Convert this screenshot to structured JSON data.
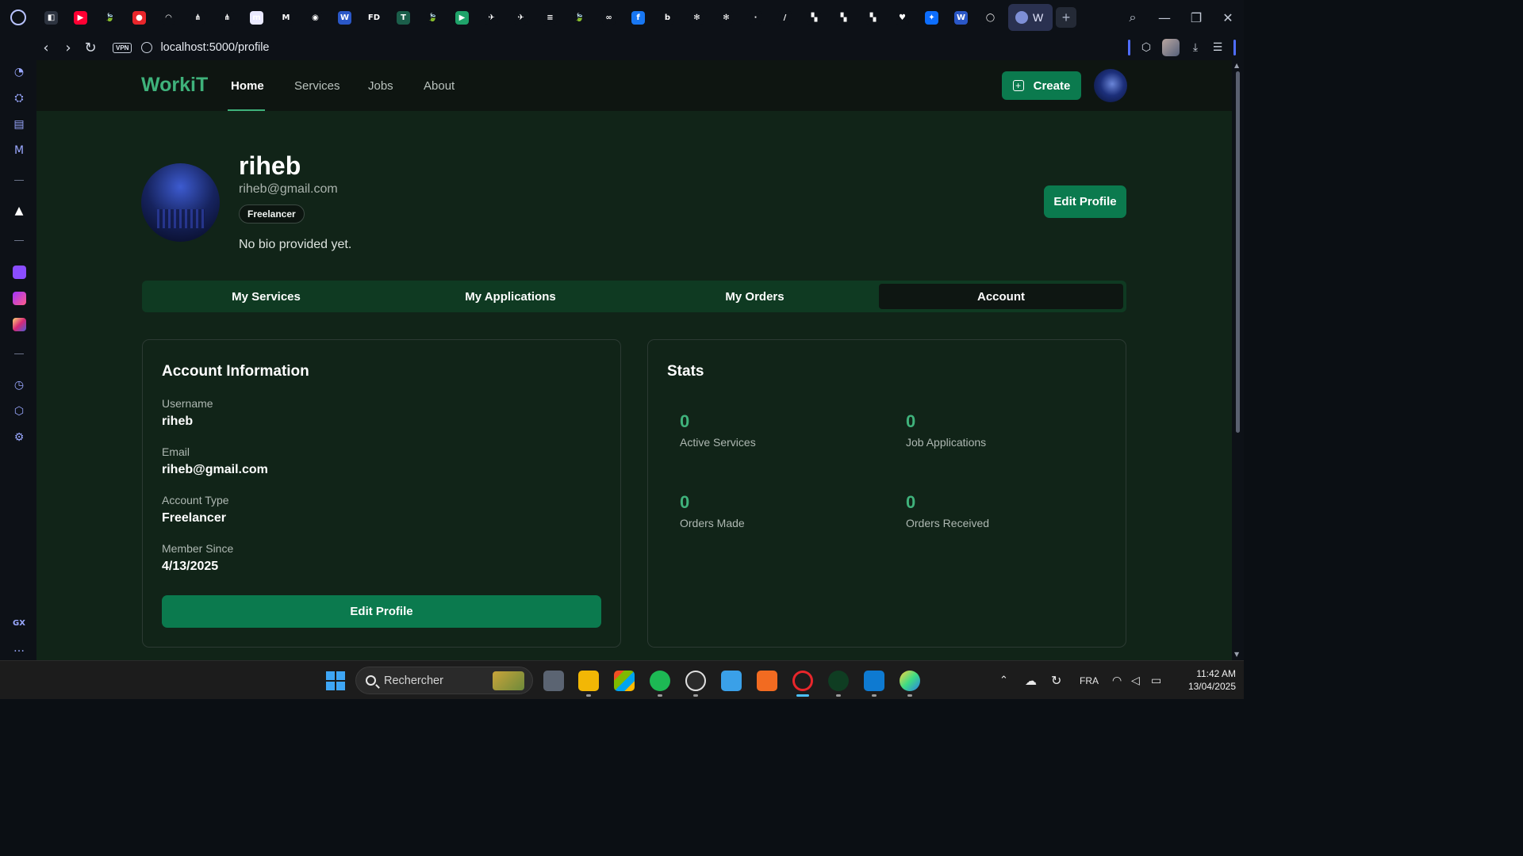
{
  "browser": {
    "active_tab_label": "W",
    "new_tab_symbol": "+",
    "url": "localhost:5000/profile",
    "vpn_label": "VPN",
    "sidebar_bottom_label": "GX",
    "favicons": [
      {
        "name": "gamepad-icon",
        "color": "#2d3440",
        "glyph": "◧"
      },
      {
        "name": "youtube-icon",
        "color": "#ff0033",
        "glyph": "▶"
      },
      {
        "name": "mongodb-leaf-icon",
        "color": "#0d1117",
        "glyph": "🍃"
      },
      {
        "name": "red-app-icon",
        "color": "#e8262b",
        "glyph": "●"
      },
      {
        "name": "speedometer-icon",
        "color": "#0d1117",
        "glyph": "◠"
      },
      {
        "name": "network-icon",
        "color": "#0d1117",
        "glyph": "⋔"
      },
      {
        "name": "network-icon-2",
        "color": "#0d1117",
        "glyph": "⋔"
      },
      {
        "name": "mastodon-icon",
        "color": "#e9e9ff",
        "glyph": "m"
      },
      {
        "name": "gmail-icon",
        "color": "#0d1117",
        "glyph": "M"
      },
      {
        "name": "github-icon",
        "color": "#0d1117",
        "glyph": "◉"
      },
      {
        "name": "word-icon",
        "color": "#2a57c7",
        "glyph": "W"
      },
      {
        "name": "fd-icon",
        "color": "#0d1117",
        "glyph": "FD"
      },
      {
        "name": "t-app-icon",
        "color": "#1b5e4a",
        "glyph": "T"
      },
      {
        "name": "mongodb-leaf-icon-2",
        "color": "#0d1117",
        "glyph": "🍃"
      },
      {
        "name": "play-circle-icon",
        "color": "#1fa36a",
        "glyph": "▶"
      },
      {
        "name": "pigeon-icon",
        "color": "#0d1117",
        "glyph": "✈"
      },
      {
        "name": "pigeon-icon-2",
        "color": "#0d1117",
        "glyph": "✈"
      },
      {
        "name": "stack-icon",
        "color": "#0d1117",
        "glyph": "≡"
      },
      {
        "name": "mongodb-leaf-icon-3",
        "color": "#0d1117",
        "glyph": "🍃"
      },
      {
        "name": "infinity-icon",
        "color": "#0d1117",
        "glyph": "∞"
      },
      {
        "name": "facebook-icon",
        "color": "#1877f2",
        "glyph": "f"
      },
      {
        "name": "b-app-icon",
        "color": "#0d1117",
        "glyph": "b"
      },
      {
        "name": "chatgpt-icon",
        "color": "#0d1117",
        "glyph": "✻"
      },
      {
        "name": "chatgpt-icon-2",
        "color": "#0d1117",
        "glyph": "✻"
      },
      {
        "name": "dot-app-icon",
        "color": "#0d1117",
        "glyph": "·"
      },
      {
        "name": "slash-app-icon",
        "color": "#0d1117",
        "glyph": "/"
      },
      {
        "name": "orange-app-icon",
        "color": "#0d1117",
        "glyph": "▚"
      },
      {
        "name": "orange-app-icon-2",
        "color": "#0d1117",
        "glyph": "▚"
      },
      {
        "name": "orange-app-icon-3",
        "color": "#0d1117",
        "glyph": "▚"
      },
      {
        "name": "heart-app-icon",
        "color": "#0d1117",
        "glyph": "♥"
      },
      {
        "name": "butterfly-icon",
        "color": "#0d6efd",
        "glyph": "✦"
      },
      {
        "name": "word-icon-2",
        "color": "#2a57c7",
        "glyph": "W"
      },
      {
        "name": "circle-app-icon",
        "color": "#0d1117",
        "glyph": "◯"
      }
    ]
  },
  "site": {
    "brand": "WorkiT",
    "nav": {
      "home": "Home",
      "services": "Services",
      "jobs": "Jobs",
      "about": "About"
    },
    "create_label": "Create"
  },
  "profile": {
    "name": "riheb",
    "email": "riheb@gmail.com",
    "role": "Freelancer",
    "bio": "No bio provided yet.",
    "edit_label": "Edit Profile"
  },
  "tabs": [
    "My Services",
    "My Applications",
    "My Orders",
    "Account"
  ],
  "account": {
    "title": "Account Information",
    "username_label": "Username",
    "username": "riheb",
    "email_label": "Email",
    "email": "riheb@gmail.com",
    "type_label": "Account Type",
    "type": "Freelancer",
    "since_label": "Member Since",
    "since": "4/13/2025",
    "edit_label": "Edit Profile"
  },
  "stats": {
    "title": "Stats",
    "active_services": {
      "value": "0",
      "label": "Active Services"
    },
    "job_applications": {
      "value": "0",
      "label": "Job Applications"
    },
    "orders_made": {
      "value": "0",
      "label": "Orders Made"
    },
    "orders_received": {
      "value": "0",
      "label": "Orders Received"
    }
  },
  "taskbar": {
    "search_placeholder": "Rechercher",
    "language": "FRA",
    "time": "11:42 AM",
    "date": "13/04/2025"
  },
  "colors": {
    "accent": "#3fb27b",
    "button": "#0b7a4e",
    "page_bg": "#112418",
    "navbar_bg": "#0e1511"
  }
}
